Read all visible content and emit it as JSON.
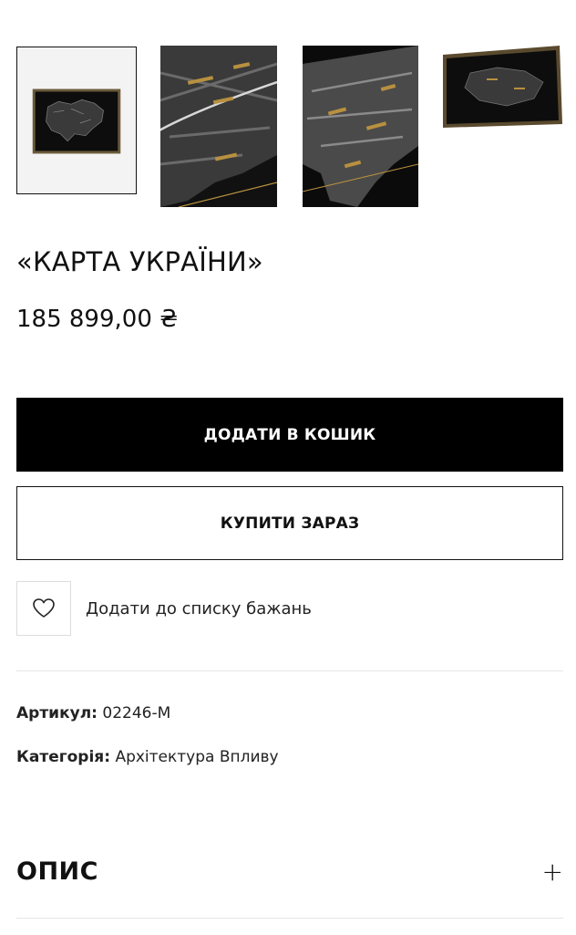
{
  "gallery": {
    "thumbnails": [
      {
        "icon": "framed-map-icon",
        "selected": true
      },
      {
        "icon": "map-closeup-icon",
        "selected": false
      },
      {
        "icon": "map-relief-icon",
        "selected": false
      },
      {
        "icon": "map-angled-frame-icon",
        "selected": false
      }
    ]
  },
  "product": {
    "title": "«КАРТА УКРАЇНИ»",
    "price": "185 899,00 ₴"
  },
  "actions": {
    "add_to_cart": "ДОДАТИ В КОШИК",
    "buy_now": "КУПИТИ ЗАРАЗ",
    "wishlist_label": "Додати до списку бажань",
    "wishlist_icon": "heart-icon"
  },
  "meta": {
    "sku_label": "Артикул:",
    "sku_value": "02246-M",
    "category_label": "Категорія:",
    "category_value": "Архітектура Впливу"
  },
  "description": {
    "title": "ОПИС",
    "toggle": "+"
  },
  "colors": {
    "primary": "#000000",
    "accent_gold": "#b8903f"
  }
}
